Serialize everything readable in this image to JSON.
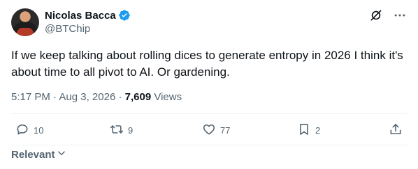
{
  "author": {
    "display_name": "Nicolas Bacca",
    "handle": "@BTChip",
    "verified": true,
    "verified_color": "#1d9bf0"
  },
  "tweet": {
    "text": "If we keep talking about rolling dices to generate entropy in 2026 I think it's about time to all pivot to AI. Or gardening.",
    "time": "5:17 PM",
    "separator": "·",
    "date": "Aug 3, 2026",
    "views_count": "7,609",
    "views_label": "Views"
  },
  "actions": {
    "replies": "10",
    "reposts": "9",
    "likes": "77",
    "bookmarks": "2"
  },
  "sort": {
    "label": "Relevant"
  },
  "icons": {
    "top": [
      "grok-slash-icon",
      "more-icon"
    ],
    "actions": [
      "reply-icon",
      "repost-icon",
      "like-icon",
      "bookmark-icon",
      "share-icon"
    ]
  }
}
